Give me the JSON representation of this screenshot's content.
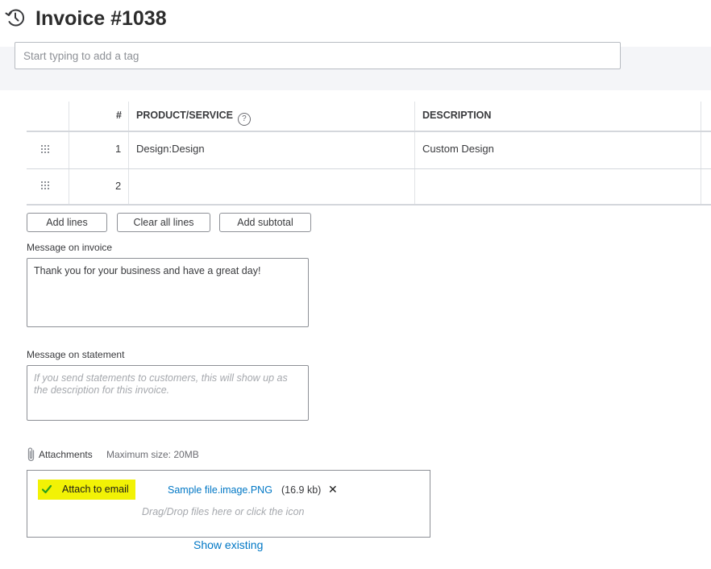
{
  "header": {
    "title": "Invoice #1038",
    "history_icon": "history-clock-icon"
  },
  "tags": {
    "placeholder": "Start typing to add a tag"
  },
  "table": {
    "columns": [
      "#",
      "PRODUCT/SERVICE",
      "DESCRIPTION"
    ],
    "rows": [
      {
        "num": "1",
        "product": "Design:Design",
        "description": "Custom Design"
      },
      {
        "num": "2",
        "product": "",
        "description": ""
      }
    ]
  },
  "buttons": {
    "add_lines": "Add lines",
    "clear_all": "Clear all lines",
    "add_subtotal": "Add subtotal"
  },
  "message_invoice": {
    "label": "Message on invoice",
    "value": "Thank you for your business and have a great day!"
  },
  "message_statement": {
    "label": "Message on statement",
    "placeholder": "If you send statements to customers, this will show up as the description for this invoice."
  },
  "attachments": {
    "label": "Attachments",
    "max_size": "Maximum size: 20MB",
    "attach_to_email": "Attach to email",
    "attach_checked": true,
    "file_name": "Sample file.image.PNG",
    "file_size": "(16.9 kb)",
    "remove_glyph": "✕",
    "drop_hint": "Drag/Drop files here or click the icon",
    "show_existing": "Show existing"
  },
  "colors": {
    "link": "#0077c5",
    "highlight": "#f2f205",
    "check": "#2ca01c"
  }
}
